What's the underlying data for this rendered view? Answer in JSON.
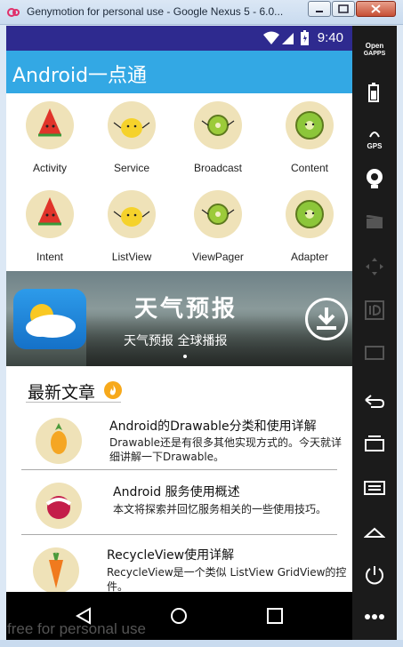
{
  "window": {
    "title": "Genymotion for personal use - Google Nexus 5 - 6.0..."
  },
  "status_bar": {
    "time": "9:40"
  },
  "app_bar": {
    "title": "Android一点通"
  },
  "grid": {
    "items": [
      {
        "label": "Activity",
        "icon": "watermelon-icon"
      },
      {
        "label": "Service",
        "icon": "lemon-icon"
      },
      {
        "label": "Broadcast",
        "icon": "kiwi-icon"
      },
      {
        "label": "Content",
        "icon": "kiwi-slice-icon"
      },
      {
        "label": "Intent",
        "icon": "watermelon-icon"
      },
      {
        "label": "ListView",
        "icon": "lemon-icon"
      },
      {
        "label": "ViewPager",
        "icon": "kiwi-icon"
      },
      {
        "label": "Adapter",
        "icon": "kiwi-slice-icon"
      }
    ]
  },
  "banner": {
    "title": "天气预报",
    "subtitle": "天气预报 全球播报",
    "icon": "weather-icon"
  },
  "articles_section": {
    "title": "最新文章"
  },
  "articles": [
    {
      "title": "Android的Drawable分类和使用详解",
      "desc_line1": "Drawable还是有很多其他实现方式的。今天就详",
      "desc_line2": "细讲解一下Drawable。",
      "icon": "pineapple-icon"
    },
    {
      "title": "Android 服务使用概述",
      "desc_line1": "本文将探索并回忆服务相关的一些使用技巧。",
      "desc_line2": "",
      "icon": "lychee-icon"
    },
    {
      "title": "RecycleView使用详解",
      "desc_line1": "RecycleView是一个类似 ListView GridView的控",
      "desc_line2": "件。",
      "icon": "carrot-icon"
    }
  ],
  "watermark": "free for personal use",
  "sidebar": {
    "items": [
      {
        "label_line1": "Open",
        "label_line2": "GAPPS"
      },
      {
        "label": "battery"
      },
      {
        "label_line1": "GPS"
      }
    ]
  },
  "colors": {
    "app_bar": "#33a8e4",
    "status_bar": "#2e2a8f"
  }
}
